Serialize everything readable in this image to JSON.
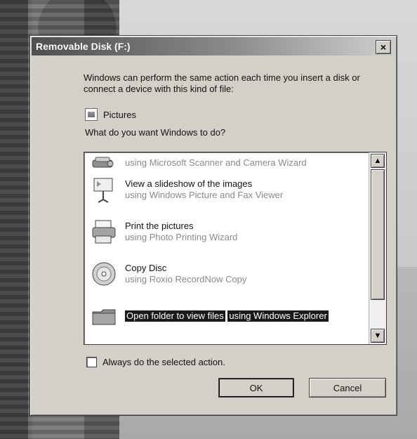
{
  "dialog": {
    "title": "Removable Disk (F:)",
    "close_glyph": "×",
    "description": "Windows can perform the same action each time you insert a disk or connect a device with this kind of file:",
    "content_type_label": "Pictures",
    "question": "What do you want Windows to do?",
    "actions": [
      {
        "title": "",
        "subtitle": "using Microsoft Scanner and Camera Wizard",
        "icon": "scanner-camera-icon"
      },
      {
        "title": "View a slideshow of the images",
        "subtitle": "using Windows Picture and Fax Viewer",
        "icon": "projector-screen-icon"
      },
      {
        "title": "Print the pictures",
        "subtitle": "using Photo Printing Wizard",
        "icon": "printer-icon"
      },
      {
        "title": "Copy Disc",
        "subtitle": "using Roxio RecordNow Copy",
        "icon": "disc-icon"
      },
      {
        "title": "Open folder to view files",
        "subtitle": "using Windows Explorer",
        "icon": "folder-icon",
        "selected": true
      }
    ],
    "always_label": "Always do the selected action.",
    "ok_label": "OK",
    "cancel_label": "Cancel",
    "scroll_up_glyph": "▲",
    "scroll_down_glyph": "▼"
  }
}
